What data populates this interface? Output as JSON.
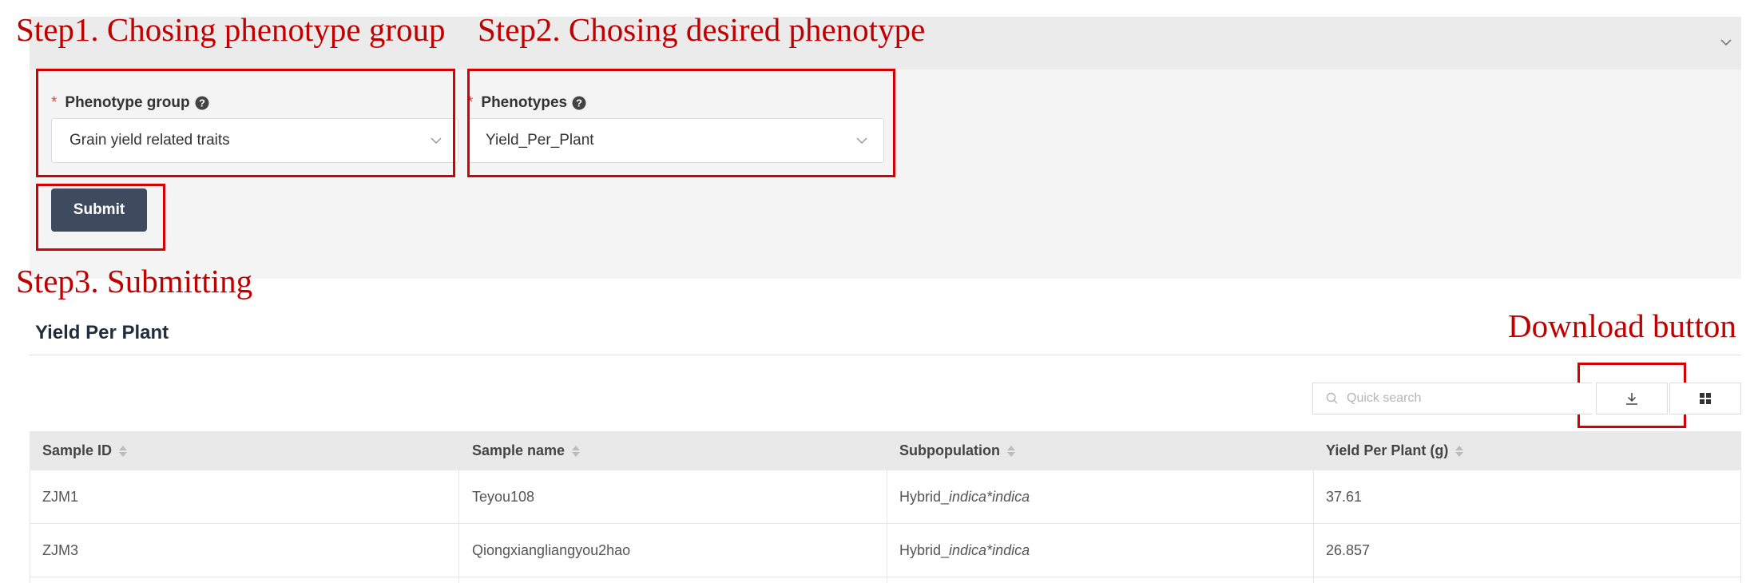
{
  "annotations": {
    "step1": "Step1. Chosing phenotype group",
    "step2": "Step2. Chosing desired phenotype",
    "step3": "Step3. Submitting",
    "download": "Download button",
    "color": "#c00000"
  },
  "form": {
    "group_label": "Phenotype group",
    "group_value": "Grain yield related traits",
    "phenotype_label": "Phenotypes",
    "phenotype_value": "Yield_Per_Plant",
    "required_mark": "*",
    "submit_label": "Submit",
    "submit_color": "#3e4b5e"
  },
  "results": {
    "title": "Yield Per Plant",
    "search_placeholder": "Quick search",
    "columns": [
      "Sample ID",
      "Sample name",
      "Subpopulation",
      "Yield Per Plant (g)"
    ],
    "rows": [
      {
        "id": "ZJM1",
        "name": "Teyou108",
        "subpop_prefix": "Hybrid_",
        "subpop_italic": "indica*indica",
        "yield": "37.61"
      },
      {
        "id": "ZJM3",
        "name": "Qiongxiangliangyou2hao",
        "subpop_prefix": "Hybrid_",
        "subpop_italic": "indica*indica",
        "yield": "26.857"
      }
    ]
  },
  "icons": [
    "help-icon",
    "chevron-down-icon",
    "search-icon",
    "download-icon",
    "grid-icon",
    "sort-icon"
  ]
}
